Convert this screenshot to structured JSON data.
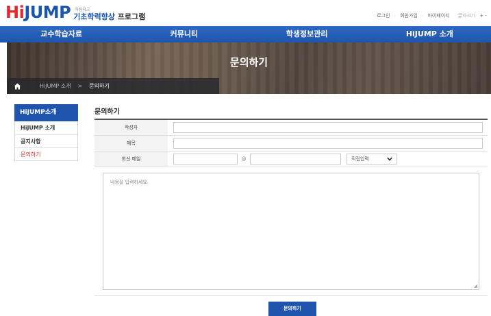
{
  "header": {
    "logo_hi": "Hi",
    "logo_jump": "JUMP",
    "logo_small": "하림지고",
    "logo_prog_blue": "기초학력향상",
    "logo_prog_dark": " 프로그램",
    "util": {
      "login": "로그인",
      "signup": "회원가입",
      "mypage": "마이페이지",
      "font_size": "글자크기",
      "font_ctrl": "+ -"
    }
  },
  "nav": {
    "items": [
      {
        "label": "교수학습자료"
      },
      {
        "label": "커뮤니티"
      },
      {
        "label": "학생정보관리"
      },
      {
        "label": "HiJUMP 소개"
      }
    ]
  },
  "banner": {
    "title": "문의하기",
    "breadcrumb": {
      "level1": "HiJUMP 소개",
      "separator": ">",
      "level2": "문의하기"
    }
  },
  "sidebar": {
    "heading": "HiJUMP소개",
    "items": [
      {
        "label": "HiJUMP 소개"
      },
      {
        "label": "공지사항"
      },
      {
        "label": "문의하기"
      }
    ]
  },
  "main": {
    "title": "문의하기",
    "form": {
      "author_label": "작성자",
      "author_value": "",
      "subject_label": "제목",
      "subject_value": "",
      "email_label": "회신 메일",
      "email_local": "",
      "email_at": "@",
      "email_domain": "",
      "domain_select": "직접입력",
      "content_placeholder": "내용을 입력하세요."
    },
    "submit_label": "문의하기"
  },
  "colors": {
    "brand_blue": "#1f55ad",
    "brand_red": "#e8262a"
  }
}
